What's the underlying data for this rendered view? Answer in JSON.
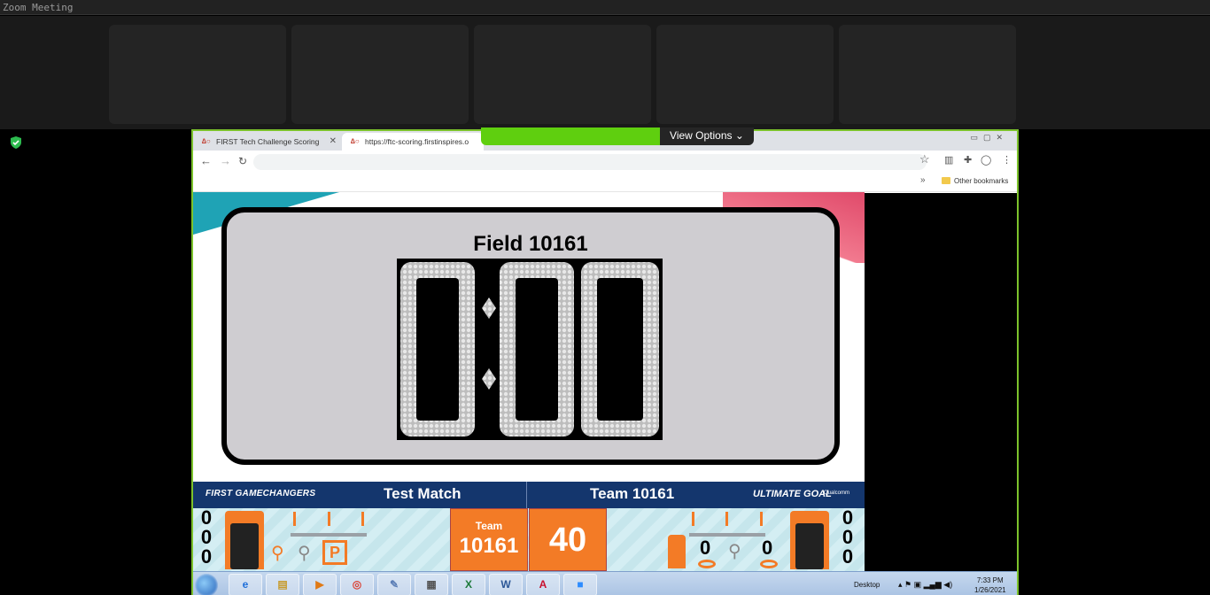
{
  "window": {
    "title": "Zoom Meeting"
  },
  "zoom": {
    "view_options_label": "View Options",
    "view_options_chevron": "⌄"
  },
  "browser": {
    "tabs": [
      {
        "label": "FIRST Tech Challenge Scoring"
      },
      {
        "label": "https://ftc-scoring.firstinspires.o"
      }
    ],
    "bookmarks": {
      "other_label": "Other bookmarks",
      "more_glyph": "»"
    }
  },
  "scoreboard": {
    "field_title": "Field 10161",
    "timer": "0:00",
    "brand_left": "FIRST GAMECHANGERS",
    "match_name": "Test Match",
    "team_heading": "Team 10161",
    "brand_right": "ULTIMATE GOAL",
    "sponsor": "Qualcomm",
    "team_card_label": "Team",
    "team_card_number": "10161",
    "score": "40",
    "left_digits": [
      "0",
      "0",
      "0"
    ],
    "right_digits": [
      "0",
      "0",
      "0"
    ],
    "ring_counts": [
      "0",
      "0"
    ],
    "park_letter": "P"
  },
  "taskbar": {
    "apps": [
      "e",
      "▤",
      "▶",
      "◎",
      "✎",
      "▦",
      "X",
      "W",
      "A",
      "■"
    ],
    "tray_label": "Desktop",
    "time": "7:33 PM",
    "date": "1/26/2021"
  },
  "colors": {
    "zoom_green": "#7cc22b",
    "ftc_orange": "#f37b26",
    "ftc_navy": "#14366d"
  }
}
